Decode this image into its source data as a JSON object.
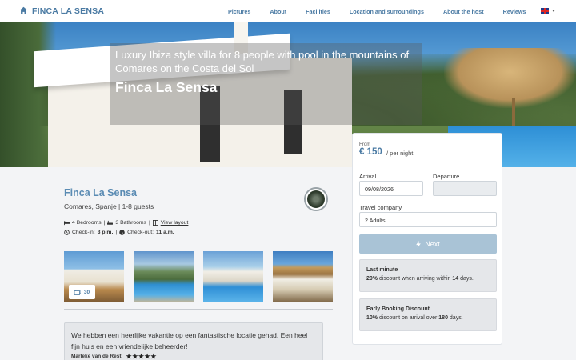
{
  "nav": {
    "brand": "FINCA LA SENSA",
    "links": [
      "Pictures",
      "About",
      "Facilities",
      "Location and surroundings",
      "About the host",
      "Reviews"
    ]
  },
  "hero": {
    "subtitle": "Luxury Ibiza style villa for 8 people with pool in the mountains of Comares on the Costa del Sol",
    "title": "Finca La Sensa"
  },
  "listing": {
    "name": "Finca La Sensa",
    "location": "Comares, Spanje | 1-8 guests",
    "bedrooms": "4 Bedrooms",
    "bathrooms": "3 Bathrooms",
    "layout_link": "View layout",
    "checkin_label": "Check-in:",
    "checkin_time": "3 p.m.",
    "checkout_label": "Check-out:",
    "checkout_time": "11 a.m.",
    "photo_count": "30"
  },
  "booking": {
    "from_label": "From",
    "price": "€ 150",
    "per_night": "/ per night",
    "arrival_label": "Arrival",
    "arrival_value": "09/08/2026",
    "departure_label": "Departure",
    "departure_value": "",
    "company_label": "Travel company",
    "company_value": "2 Adults",
    "next_label": "Next",
    "promos": [
      {
        "title": "Last minute",
        "pct": "20%",
        "text_mid": " discount when arriving within ",
        "num": "14",
        "text_end": " days."
      },
      {
        "title": "Early Booking Discount",
        "pct": "10%",
        "text_mid": " discount on arrival over ",
        "num": "180",
        "text_end": " days."
      }
    ]
  },
  "review": {
    "text": "We hebben een heerlijke vakantie op een fantastische locatie gehad. Een heel fijn huis en een vriendelijke beheerder!",
    "author": "Marleke van de Rest",
    "stars": "★★★★★"
  },
  "colors": {
    "brand": "#4a7aa3",
    "next_button": "#a9c3d6"
  }
}
